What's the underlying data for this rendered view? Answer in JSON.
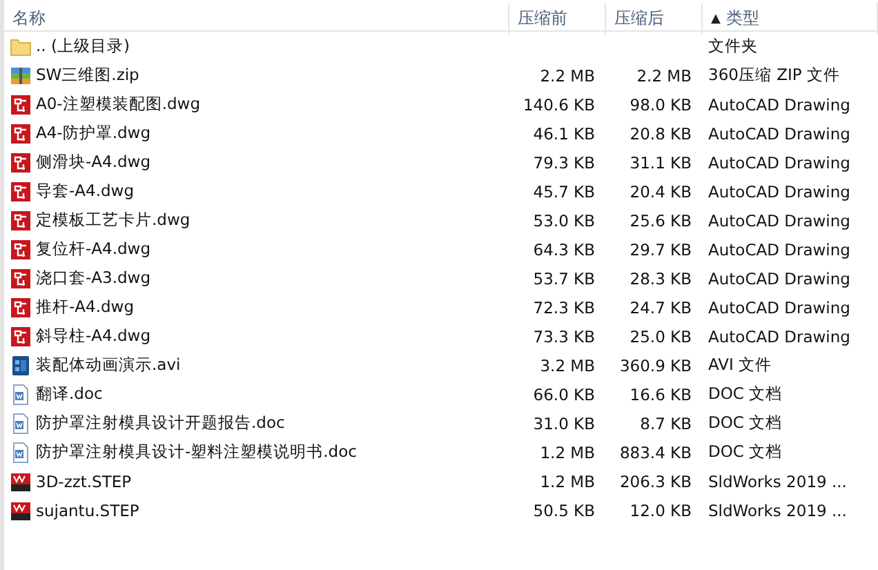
{
  "columns": [
    {
      "label": "名称"
    },
    {
      "label": "压缩前"
    },
    {
      "label": "压缩后"
    },
    {
      "label": "类型",
      "sort_indicator": "▲"
    }
  ],
  "rows": [
    {
      "kind": "folder",
      "name": ".. (上级目录)",
      "before": "",
      "after": "",
      "type": "文件夹"
    },
    {
      "kind": "zip",
      "name": "SW三维图.zip",
      "before": "2.2 MB",
      "after": "2.2 MB",
      "type": "360压缩 ZIP 文件"
    },
    {
      "kind": "dwg",
      "name": "A0-注塑模装配图.dwg",
      "before": "140.6 KB",
      "after": "98.0 KB",
      "type": "AutoCAD Drawing"
    },
    {
      "kind": "dwg",
      "name": "A4-防护罩.dwg",
      "before": "46.1 KB",
      "after": "20.8 KB",
      "type": "AutoCAD Drawing"
    },
    {
      "kind": "dwg",
      "name": "侧滑块-A4.dwg",
      "before": "79.3 KB",
      "after": "31.1 KB",
      "type": "AutoCAD Drawing"
    },
    {
      "kind": "dwg",
      "name": "导套-A4.dwg",
      "before": "45.7 KB",
      "after": "20.4 KB",
      "type": "AutoCAD Drawing"
    },
    {
      "kind": "dwg",
      "name": "定模板工艺卡片.dwg",
      "before": "53.0 KB",
      "after": "25.6 KB",
      "type": "AutoCAD Drawing"
    },
    {
      "kind": "dwg",
      "name": "复位杆-A4.dwg",
      "before": "64.3 KB",
      "after": "29.7 KB",
      "type": "AutoCAD Drawing"
    },
    {
      "kind": "dwg",
      "name": "浇口套-A3.dwg",
      "before": "53.7 KB",
      "after": "28.3 KB",
      "type": "AutoCAD Drawing"
    },
    {
      "kind": "dwg",
      "name": "推杆-A4.dwg",
      "before": "72.3 KB",
      "after": "24.7 KB",
      "type": "AutoCAD Drawing"
    },
    {
      "kind": "dwg",
      "name": "斜导柱-A4.dwg",
      "before": "73.3 KB",
      "after": "25.0 KB",
      "type": "AutoCAD Drawing"
    },
    {
      "kind": "avi",
      "name": "装配体动画演示.avi",
      "before": "3.2 MB",
      "after": "360.9 KB",
      "type": "AVI 文件"
    },
    {
      "kind": "doc",
      "name": "翻译.doc",
      "before": "66.0 KB",
      "after": "16.6 KB",
      "type": "DOC 文档"
    },
    {
      "kind": "doc",
      "name": "防护罩注射模具设计开题报告.doc",
      "before": "31.0 KB",
      "after": "8.7 KB",
      "type": "DOC 文档"
    },
    {
      "kind": "doc",
      "name": "防护罩注射模具设计-塑料注塑模说明书.doc",
      "before": "1.2 MB",
      "after": "883.4 KB",
      "type": "DOC 文档"
    },
    {
      "kind": "step",
      "name": "3D-zzt.STEP",
      "before": "1.2 MB",
      "after": "206.3 KB",
      "type": "SldWorks 2019 ..."
    },
    {
      "kind": "step",
      "name": "sujantu.STEP",
      "before": "50.5 KB",
      "after": "12.0 KB",
      "type": "SldWorks 2019 ..."
    }
  ]
}
